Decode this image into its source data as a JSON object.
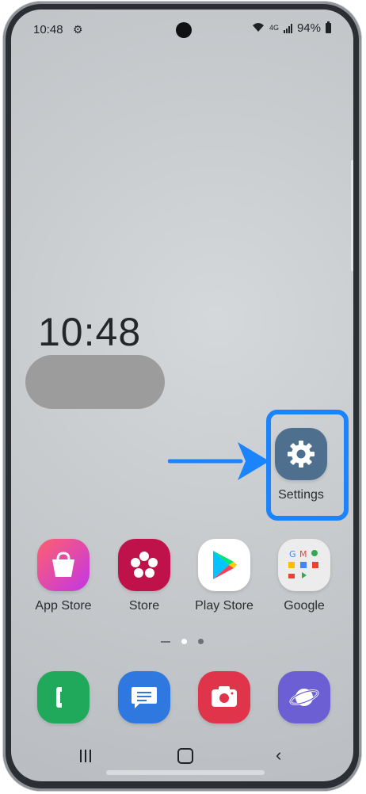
{
  "status_bar": {
    "time": "10:48",
    "network": "4G",
    "battery": "94%"
  },
  "lockscreen": {
    "clock": "10:48"
  },
  "highlight": {
    "color": "#1a84ff"
  },
  "apps": {
    "settings": {
      "label": "Settings"
    },
    "row": [
      {
        "label": "App Store",
        "icon": "shopping-bag-icon"
      },
      {
        "label": "Store",
        "icon": "flower-icon"
      },
      {
        "label": "Play Store",
        "icon": "play-store-icon"
      },
      {
        "label": "Google",
        "icon": "google-folder-icon"
      }
    ],
    "dock": [
      {
        "icon": "phone-icon"
      },
      {
        "icon": "messages-icon"
      },
      {
        "icon": "camera-icon"
      },
      {
        "icon": "browser-icon"
      }
    ]
  }
}
